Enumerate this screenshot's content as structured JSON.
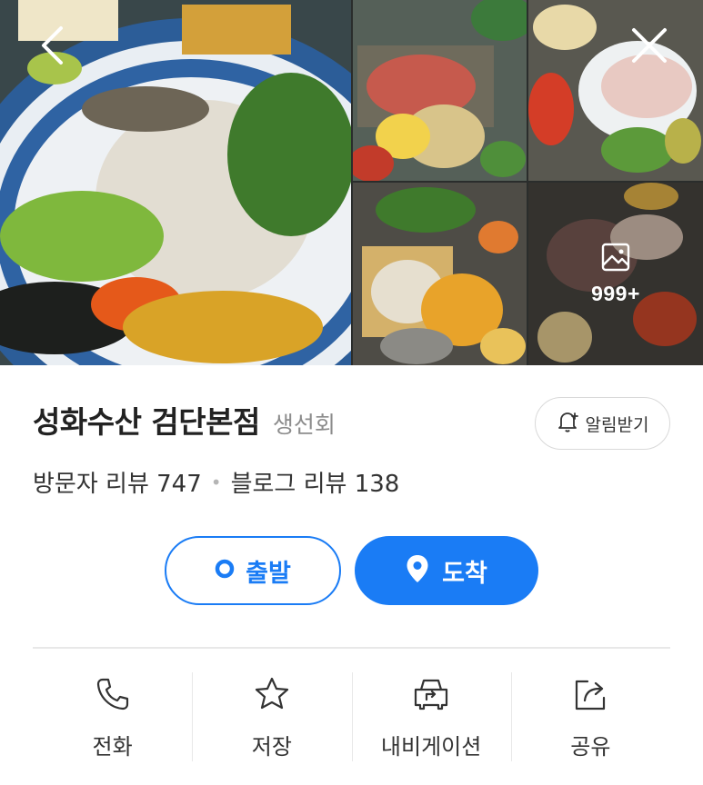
{
  "gallery": {
    "more_count": "999+"
  },
  "store": {
    "name": "성화수산 검단본점",
    "category": "생선회",
    "alarm_label": "알림받기"
  },
  "reviews": {
    "visitor": "방문자 리뷰 747",
    "blog": "블로그 리뷰 138"
  },
  "route": {
    "start_label": "출발",
    "arrive_label": "도착"
  },
  "actions": [
    {
      "label": "전화",
      "icon": "phone-icon"
    },
    {
      "label": "저장",
      "icon": "star-icon"
    },
    {
      "label": "내비게이션",
      "icon": "car-navigation-icon"
    },
    {
      "label": "공유",
      "icon": "share-icon"
    }
  ],
  "colors": {
    "accent": "#1a7cf5",
    "text": "#222222",
    "subtext": "#8c8c8c"
  }
}
